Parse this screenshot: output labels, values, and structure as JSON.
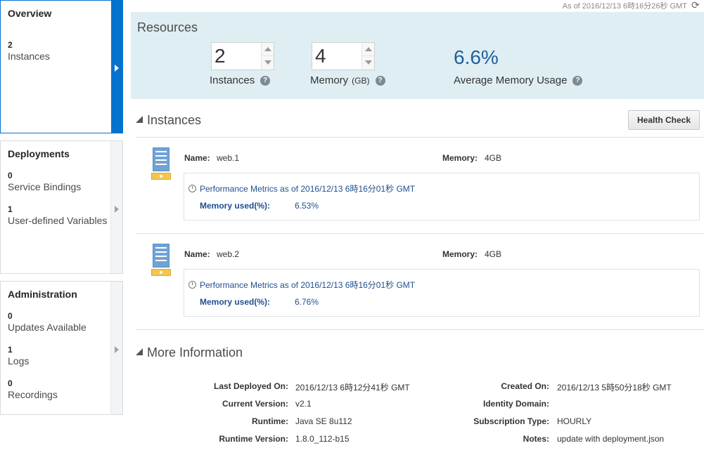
{
  "header": {
    "as_of": "As of 2016/12/13 6時16分26秒 GMT",
    "refresh_icon": "refresh-icon"
  },
  "nav": {
    "overview": {
      "title": "Overview",
      "items": [
        {
          "count": "2",
          "label": "Instances"
        }
      ]
    },
    "deployments": {
      "title": "Deployments",
      "items": [
        {
          "count": "0",
          "label": "Service Bindings"
        },
        {
          "count": "1",
          "label": "User-defined Variables"
        }
      ]
    },
    "administration": {
      "title": "Administration",
      "items": [
        {
          "count": "0",
          "label": "Updates Available"
        },
        {
          "count": "1",
          "label": "Logs"
        },
        {
          "count": "0",
          "label": "Recordings"
        }
      ]
    }
  },
  "resources": {
    "title": "Resources",
    "instances": {
      "value": "2",
      "label": "Instances"
    },
    "memory": {
      "value": "4",
      "label": "Memory",
      "unit": "(GB)"
    },
    "avg_memory": {
      "value": "6.6%",
      "label": "Average Memory Usage"
    },
    "help_glyph": "?"
  },
  "instances_section": {
    "title": "Instances",
    "health_check_label": "Health Check",
    "name_label": "Name:",
    "memory_label": "Memory:",
    "memory_used_label": "Memory used(%):",
    "items": [
      {
        "name": "web.1",
        "memory": "4GB",
        "metrics_title": "Performance Metrics as of 2016/12/13 6時16分01秒 GMT",
        "memory_used": "6.53%"
      },
      {
        "name": "web.2",
        "memory": "4GB",
        "metrics_title": "Performance Metrics as of 2016/12/13 6時16分01秒 GMT",
        "memory_used": "6.76%"
      }
    ]
  },
  "more_info": {
    "title": "More Information",
    "last_deployed_label": "Last Deployed On:",
    "last_deployed": "2016/12/13 6時12分41秒 GMT",
    "current_version_label": "Current Version:",
    "current_version": "v2.1",
    "runtime_label": "Runtime:",
    "runtime": "Java SE 8u112",
    "runtime_version_label": "Runtime Version:",
    "runtime_version": "1.8.0_112-b15",
    "created_label": "Created On:",
    "created": "2016/12/13 5時50分18秒 GMT",
    "identity_domain_label": "Identity Domain:",
    "identity_domain": "",
    "subscription_label": "Subscription Type:",
    "subscription": "HOURLY",
    "notes_label": "Notes:",
    "notes": "update with deployment.json"
  },
  "colors": {
    "accent": "#0572ce",
    "resources_bg": "#dfeef3",
    "link": "#1f4e8f",
    "value_blue": "#1f5f9f"
  }
}
